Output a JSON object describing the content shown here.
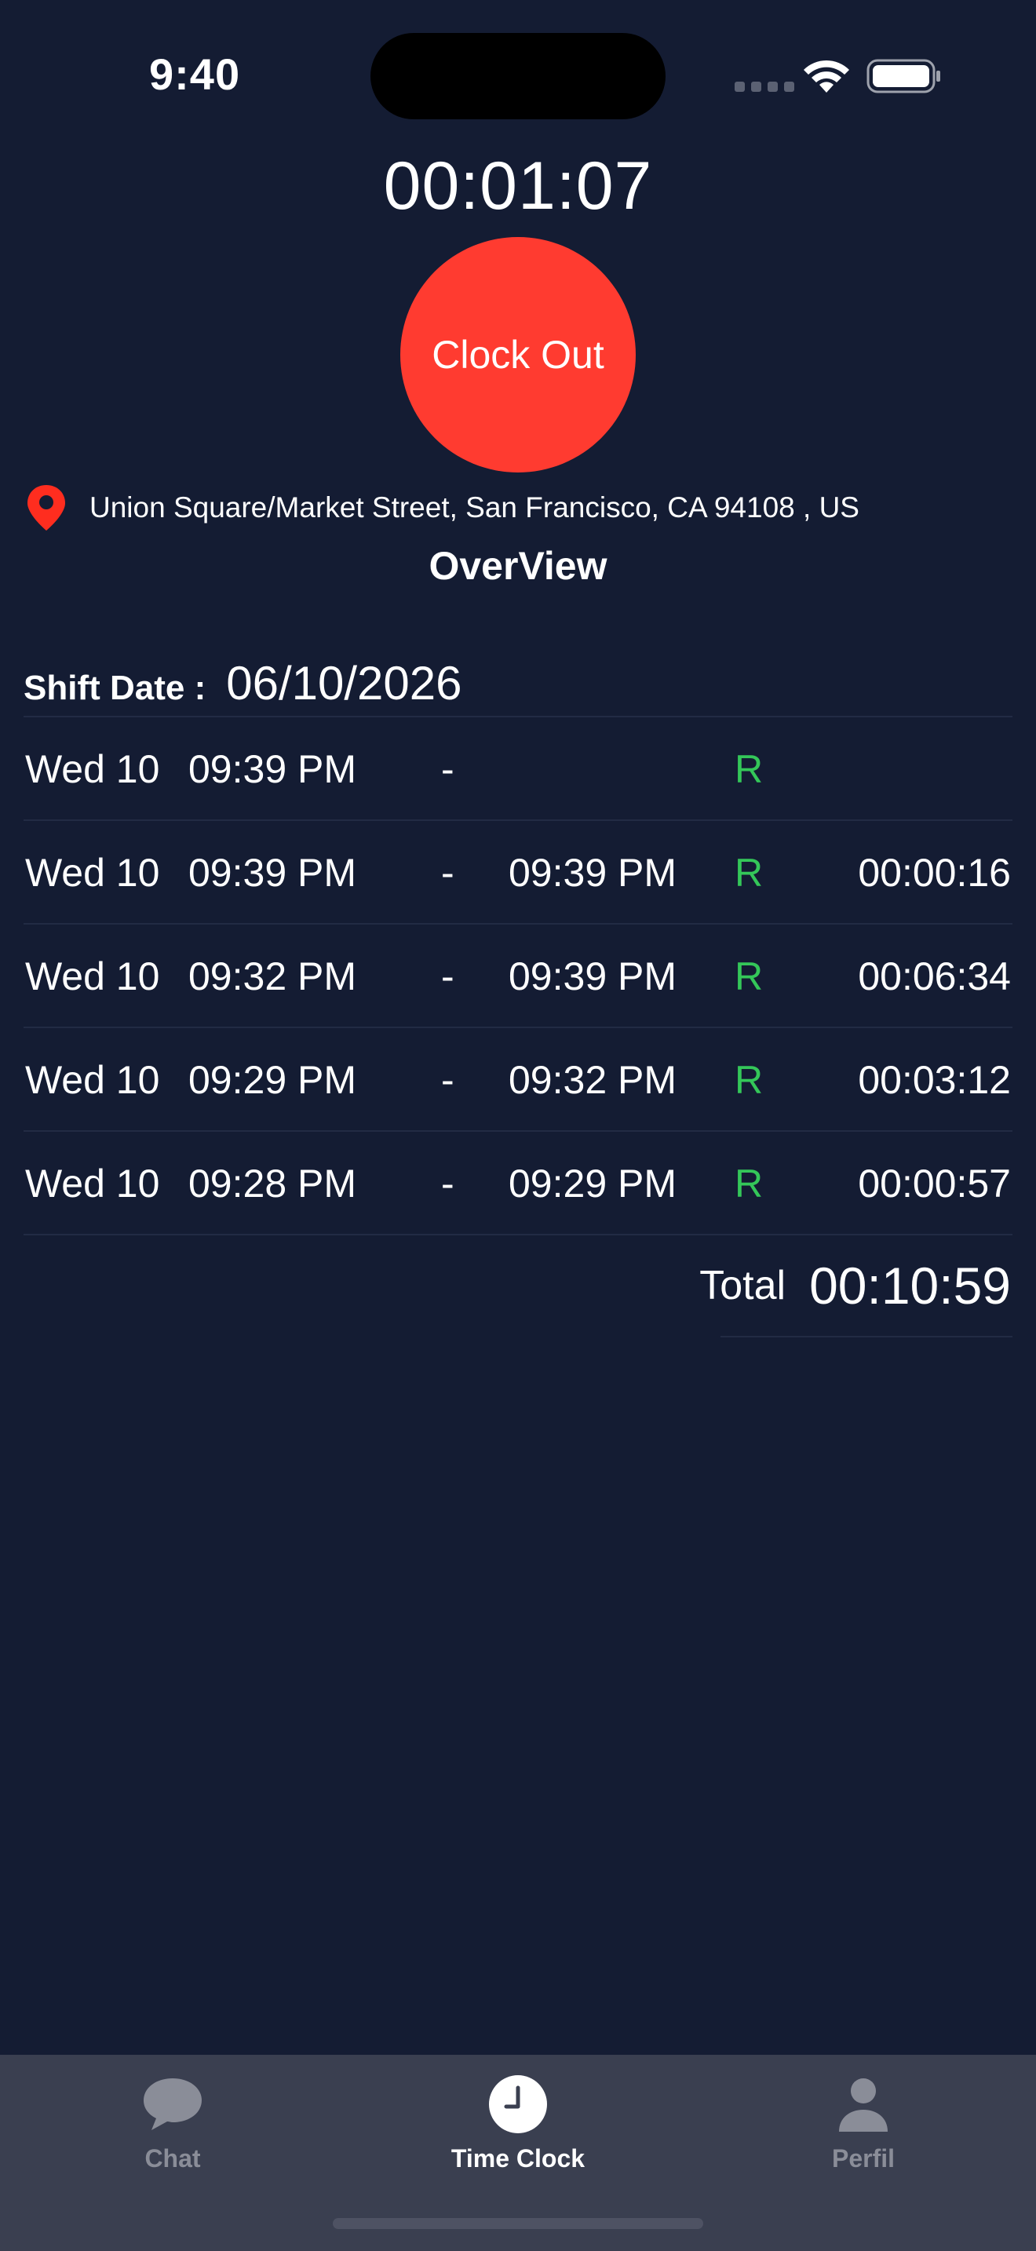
{
  "status_bar": {
    "time": "9:40"
  },
  "timer": {
    "elapsed": "00:01:07"
  },
  "clock_button": {
    "label": "Clock Out",
    "color": "#ff3b30"
  },
  "location": {
    "icon": "map-pin-icon",
    "address": "Union Square/Market Street, San Francisco, CA 94108 , US"
  },
  "overview": {
    "title": "OverView"
  },
  "shift": {
    "label": "Shift Date :",
    "date": "06/10/2026"
  },
  "entries": [
    {
      "day": "Wed 10",
      "start": "09:39 PM",
      "dash": "-",
      "end": "",
      "type": "R",
      "duration": ""
    },
    {
      "day": "Wed 10",
      "start": "09:39 PM",
      "dash": "-",
      "end": "09:39 PM",
      "type": "R",
      "duration": "00:00:16"
    },
    {
      "day": "Wed 10",
      "start": "09:32 PM",
      "dash": "-",
      "end": "09:39 PM",
      "type": "R",
      "duration": "00:06:34"
    },
    {
      "day": "Wed 10",
      "start": "09:29 PM",
      "dash": "-",
      "end": "09:32 PM",
      "type": "R",
      "duration": "00:03:12"
    },
    {
      "day": "Wed 10",
      "start": "09:28 PM",
      "dash": "-",
      "end": "09:29 PM",
      "type": "R",
      "duration": "00:00:57"
    }
  ],
  "total": {
    "label": "Total",
    "value": "00:10:59"
  },
  "tabbar": {
    "tabs": [
      {
        "label": "Chat",
        "icon": "chat-bubble-icon",
        "active": false
      },
      {
        "label": "Time Clock",
        "icon": "clock-icon",
        "active": true
      },
      {
        "label": "Perfil",
        "icon": "person-icon",
        "active": false
      }
    ]
  },
  "colors": {
    "background": "#141c33",
    "accent_red": "#ff3b30",
    "type_green": "#34c759",
    "tabbar_bg": "#3a3f50"
  }
}
